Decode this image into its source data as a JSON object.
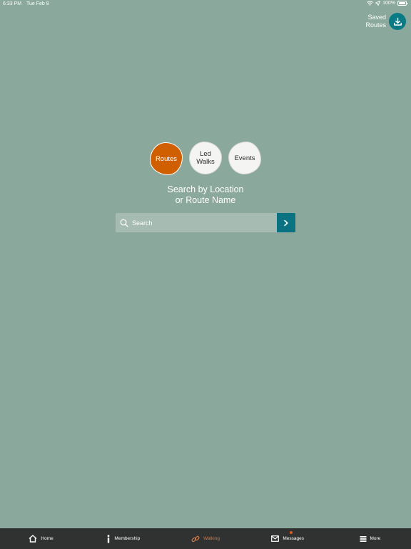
{
  "status_bar": {
    "time": "6:33 PM",
    "date": "Tue Feb 8",
    "battery": "100%"
  },
  "saved_routes": {
    "label_line1": "Saved",
    "label_line2": "Routes",
    "icon": "download-icon",
    "color": "#0a7a84"
  },
  "categories": [
    {
      "label_line1": "Routes",
      "label_line2": "",
      "active": true
    },
    {
      "label_line1": "Led",
      "label_line2": "Walks",
      "active": false
    },
    {
      "label_line1": "Events",
      "label_line2": "",
      "active": false
    }
  ],
  "search": {
    "heading_line1": "Search by Location",
    "heading_line2": "or Route Name",
    "placeholder": "Search"
  },
  "tabs": [
    {
      "label": "Home",
      "icon": "home-icon",
      "active": false
    },
    {
      "label": "Membership",
      "icon": "info-icon",
      "active": false
    },
    {
      "label": "Walking",
      "icon": "walking-link-icon",
      "active": true
    },
    {
      "label": "Messages",
      "icon": "envelope-icon",
      "active": false,
      "notification": true
    },
    {
      "label": "More",
      "icon": "menu-icon",
      "active": false
    }
  ],
  "colors": {
    "background": "#8aa89b",
    "accent": "#cf5f00",
    "teal": "#0a7281",
    "tab_bar": "#2f3231",
    "active_tab": "#d07a4c"
  }
}
